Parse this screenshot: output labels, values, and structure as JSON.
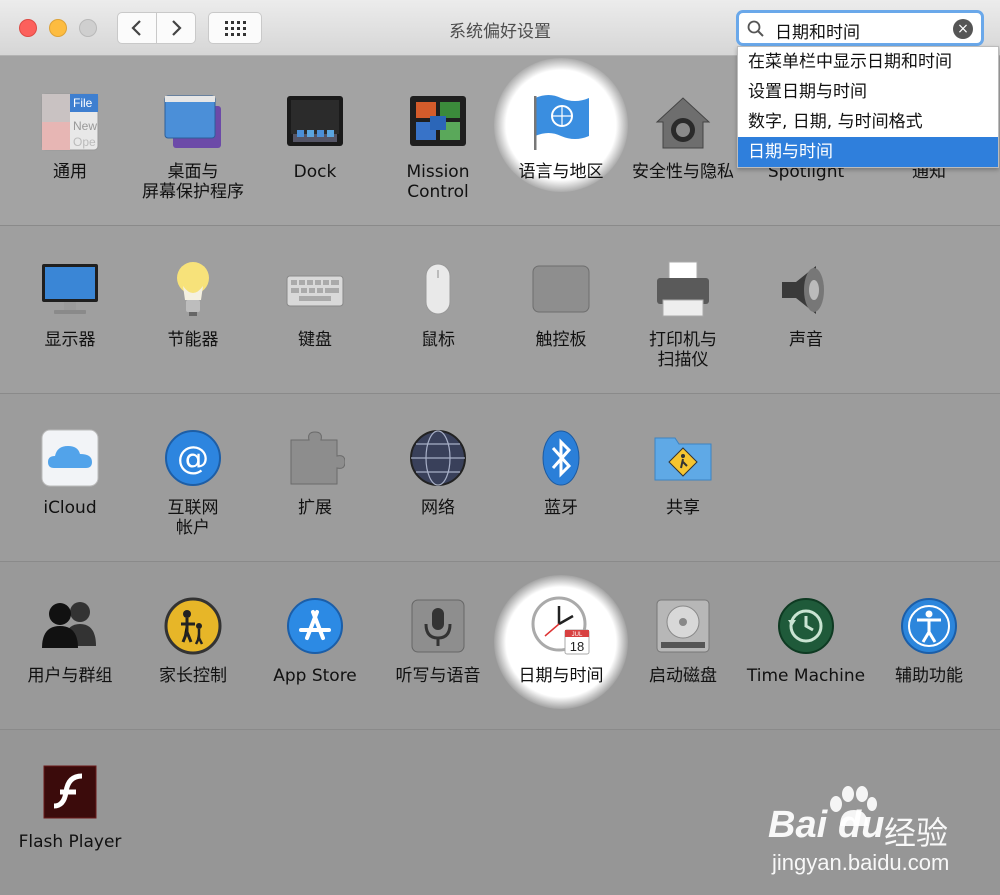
{
  "window": {
    "title": "系统偏好设置"
  },
  "search": {
    "value": "日期和时间"
  },
  "dropdown": {
    "options": [
      "在菜单栏中显示日期和时间",
      "设置日期与时间",
      "数字, 日期, 与时间格式",
      "日期与时间"
    ],
    "selected_index": 3
  },
  "rows": [
    [
      "通用",
      "桌面与\n屏幕保护程序",
      "Dock",
      "Mission\nControl",
      "语言与地区",
      "安全性与隐私",
      "Spotlight",
      "通知"
    ],
    [
      "显示器",
      "节能器",
      "键盘",
      "鼠标",
      "触控板",
      "打印机与\n扫描仪",
      "声音"
    ],
    [
      "iCloud",
      "互联网\n帐户",
      "扩展",
      "网络",
      "蓝牙",
      "共享"
    ],
    [
      "用户与群组",
      "家长控制",
      "App Store",
      "听写与语音",
      "日期与时间",
      "启动磁盘",
      "Time Machine",
      "辅助功能"
    ],
    [
      "Flash Player"
    ]
  ],
  "watermark": {
    "brand_left": "Bai",
    "brand_right": "du",
    "cn": "经验",
    "url": "jingyan.baidu.com"
  },
  "colors": {
    "accent": "#2f7fdc",
    "search_ring": "#6aa8ea",
    "background": "#9a9a9a"
  }
}
